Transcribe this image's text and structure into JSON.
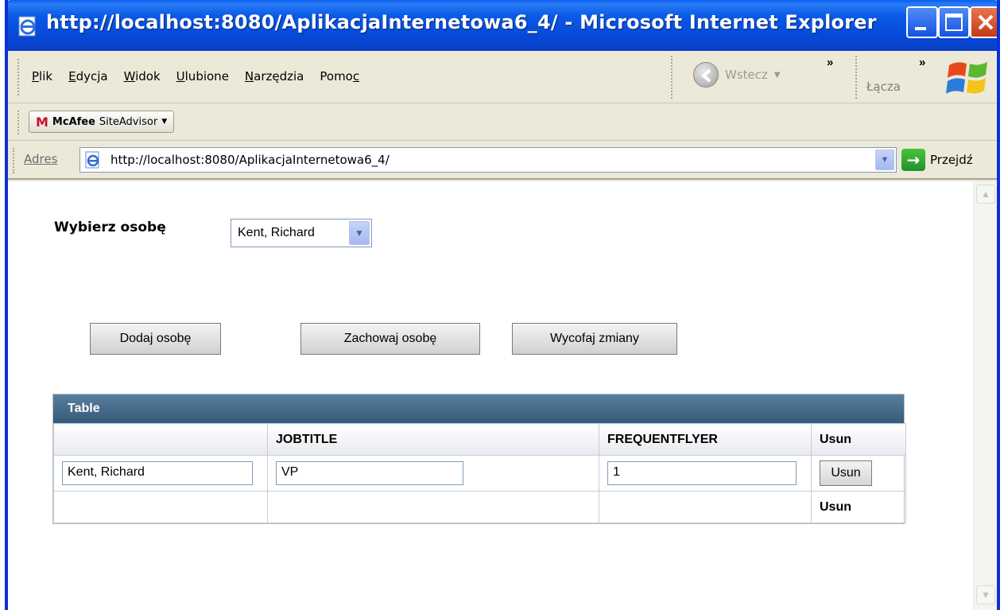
{
  "window": {
    "title": "http://localhost:8080/AplikacjaInternetowa6_4/ - Microsoft Internet Explorer"
  },
  "menu": {
    "items": [
      {
        "pre": "",
        "ul": "P",
        "post": "lik"
      },
      {
        "pre": "",
        "ul": "E",
        "post": "dycja"
      },
      {
        "pre": "",
        "ul": "W",
        "post": "idok"
      },
      {
        "pre": "",
        "ul": "U",
        "post": "lubione"
      },
      {
        "pre": "",
        "ul": "N",
        "post": "arzędzia"
      },
      {
        "pre": "Pomo",
        "ul": "c",
        "post": ""
      }
    ],
    "back_label": "Wstecz",
    "links_label": "Łącza"
  },
  "mcafee": {
    "brand": "McAfee",
    "product": "SiteAdvisor"
  },
  "address": {
    "label": "Adres",
    "url": "http://localhost:8080/AplikacjaInternetowa6_4/",
    "go_label": "Przejdź"
  },
  "form": {
    "select_label": "Wybierz osobę",
    "select_value": "Kent, Richard",
    "buttons": {
      "add": "Dodaj osobę",
      "save": "Zachowaj osobę",
      "revert": "Wycofaj zmiany"
    }
  },
  "table": {
    "title": "Table",
    "columns": [
      "",
      "JOBTITLE",
      "FREQUENTFLYER",
      "Usun"
    ],
    "rows": [
      {
        "name": "Kent, Richard",
        "jobtitle": "VP",
        "frequentflyer": "1",
        "action": "Usun"
      }
    ],
    "footer": [
      "",
      "",
      "",
      "Usun"
    ]
  }
}
